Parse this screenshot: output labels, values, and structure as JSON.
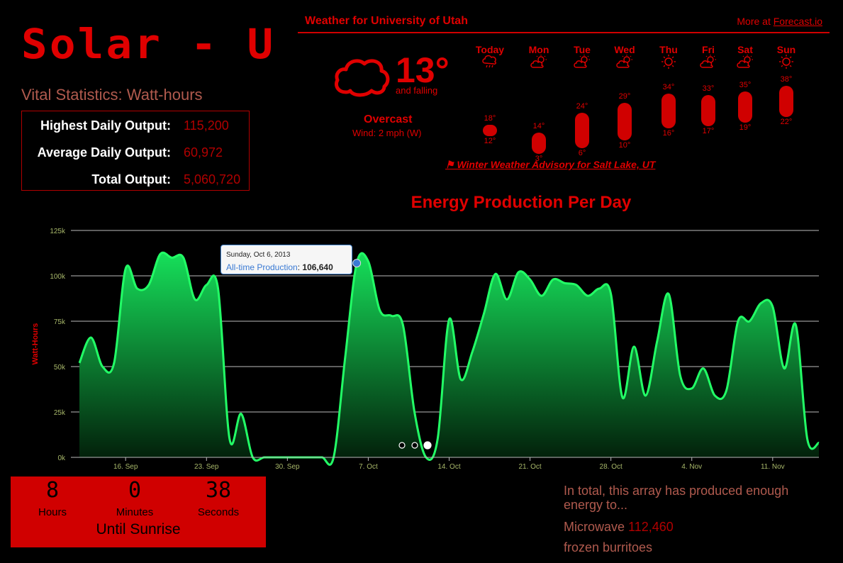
{
  "app_title": "Solar - U",
  "vitals": {
    "heading": "Vital Statistics: Watt-hours",
    "rows": [
      {
        "label": "Highest Daily Output:",
        "value": "115,200"
      },
      {
        "label": "Average Daily Output:",
        "value": "60,972"
      },
      {
        "label": "Total Output:",
        "value": "5,060,720"
      }
    ]
  },
  "weather": {
    "title": "Weather for University of Utah",
    "more_prefix": "More at ",
    "more_link": "Forecast.io",
    "current_temp": "13°",
    "trend": "and falling",
    "condition": "Overcast",
    "wind": "Wind: 2 mph (W)",
    "current_icon": "cloud-icon",
    "days": [
      {
        "name": "Today",
        "icon": "rain-icon",
        "hi": "18°",
        "lo": "12°",
        "hi_val": 18,
        "lo_val": 12
      },
      {
        "name": "Mon",
        "icon": "partly-cloudy-icon",
        "hi": "14°",
        "lo": "3°",
        "hi_val": 14,
        "lo_val": 3
      },
      {
        "name": "Tue",
        "icon": "partly-cloudy-icon",
        "hi": "24°",
        "lo": "6°",
        "hi_val": 24,
        "lo_val": 6
      },
      {
        "name": "Wed",
        "icon": "partly-cloudy-icon",
        "hi": "29°",
        "lo": "10°",
        "hi_val": 29,
        "lo_val": 10
      },
      {
        "name": "Thu",
        "icon": "sun-icon",
        "hi": "34°",
        "lo": "16°",
        "hi_val": 34,
        "lo_val": 16
      },
      {
        "name": "Fri",
        "icon": "partly-cloudy-icon",
        "hi": "33°",
        "lo": "17°",
        "hi_val": 33,
        "lo_val": 17
      },
      {
        "name": "Sat",
        "icon": "partly-cloudy-icon",
        "hi": "35°",
        "lo": "19°",
        "hi_val": 35,
        "lo_val": 19
      },
      {
        "name": "Sun",
        "icon": "sun-icon",
        "hi": "38°",
        "lo": "22°",
        "hi_val": 38,
        "lo_val": 22
      }
    ],
    "advisory": "⚑ Winter Weather Advisory for Salt Lake, UT"
  },
  "chart_data": {
    "type": "area",
    "title": "Energy Production Per Day",
    "ylabel": "Watt-Hours",
    "xlabel": "",
    "ylim": [
      0,
      125000
    ],
    "y_ticks": [
      "0k",
      "25k",
      "50k",
      "75k",
      "100k",
      "125k"
    ],
    "x_ticks": [
      "16. Sep",
      "23. Sep",
      "30. Sep",
      "7. Oct",
      "14. Oct",
      "21. Oct",
      "28. Oct",
      "4. Nov",
      "11. Nov"
    ],
    "x_start": "2013-09-12",
    "series": [
      {
        "name": "All-time Production",
        "values": [
          52000,
          66000,
          50000,
          52000,
          104000,
          93000,
          95000,
          112000,
          110000,
          110000,
          87000,
          95000,
          93000,
          10000,
          24000,
          0,
          0,
          0,
          0,
          0,
          0,
          0,
          0,
          55000,
          107000,
          108000,
          81000,
          78000,
          73000,
          25000,
          0,
          10000,
          76000,
          43000,
          58000,
          79000,
          101000,
          87000,
          102000,
          98000,
          89000,
          98000,
          96000,
          95000,
          89000,
          93000,
          90000,
          33000,
          61000,
          34000,
          64000,
          90000,
          45000,
          38000,
          49000,
          34000,
          37000,
          75000,
          75000,
          85000,
          83000,
          49000,
          73000,
          10000,
          8000
        ]
      }
    ],
    "line_color": "#22ff66",
    "grid": true
  },
  "tooltip": {
    "date": "Sunday, Oct 6, 2013",
    "series": "All-time Production",
    "value": "106,640",
    "index": 24
  },
  "countdown": {
    "hours": "8",
    "minutes": "0",
    "seconds": "38",
    "hours_label": "Hours",
    "minutes_label": "Minutes",
    "seconds_label": "Seconds",
    "caption": "Until Sunrise"
  },
  "totals": {
    "intro": "In total, this array has produced enough energy to...",
    "item_prefix": "Microwave",
    "count": "112,460",
    "item_suffix": "frozen burritoes"
  },
  "carousel": {
    "pages": 3,
    "active": 3
  }
}
